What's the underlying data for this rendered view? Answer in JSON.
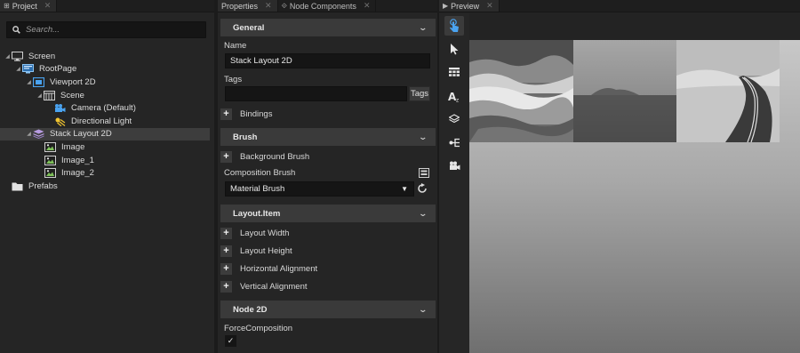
{
  "project": {
    "tab_label": "Project",
    "search_placeholder": "Search...",
    "tree": [
      {
        "label": "Screen"
      },
      {
        "label": "RootPage"
      },
      {
        "label": "Viewport 2D"
      },
      {
        "label": "Scene"
      },
      {
        "label": "Camera (Default)"
      },
      {
        "label": "Directional Light"
      },
      {
        "label": "Stack Layout 2D"
      },
      {
        "label": "Image"
      },
      {
        "label": "Image_1"
      },
      {
        "label": "Image_2"
      },
      {
        "label": "Prefabs"
      }
    ]
  },
  "properties": {
    "tab_label": "Properties",
    "tab2_label": "Node Components",
    "general": {
      "title": "General",
      "name_label": "Name",
      "name_value": "Stack Layout 2D",
      "tags_label": "Tags",
      "tags_button": "Tags",
      "bindings": "Bindings"
    },
    "brush": {
      "title": "Brush",
      "background_brush": "Background Brush",
      "composition_brush_label": "Composition Brush",
      "composition_value": "Material Brush"
    },
    "layout_item": {
      "title": "Layout.Item",
      "rows": [
        "Layout Width",
        "Layout Height",
        "Horizontal Alignment",
        "Vertical Alignment"
      ]
    },
    "node2d": {
      "title": "Node 2D",
      "force_composition_label": "ForceComposition",
      "force_composition_checked": "✓"
    }
  },
  "preview": {
    "tab_label": "Preview"
  }
}
